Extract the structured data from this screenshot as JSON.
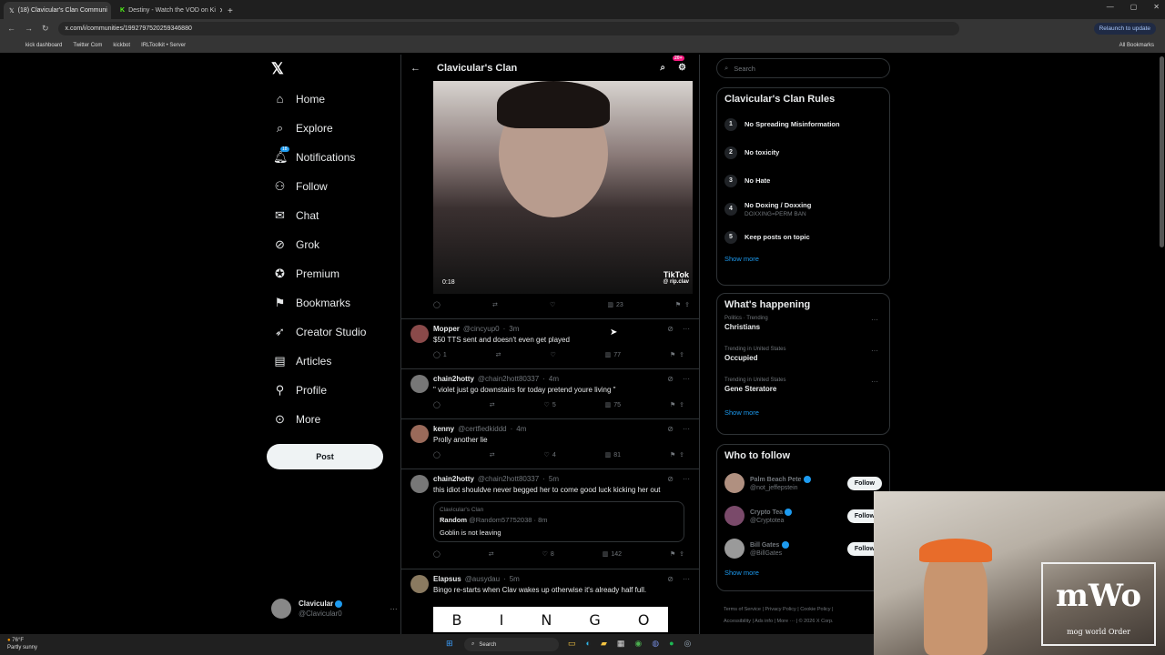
{
  "browser": {
    "tabs": [
      {
        "label": "(18) Clavicular's Clan Communi",
        "icon": "x-icon",
        "active": true
      },
      {
        "label": "Destiny - Watch the VOD on Ki",
        "icon": "kick-icon",
        "active": false
      }
    ],
    "url": "x.com/i/communities/1992797520259346880",
    "relaunch": "Relaunch to update",
    "bookmarks": [
      "kick dashboard",
      "Twitter Com",
      "kickbot",
      "IRLToolkit • Server"
    ],
    "all_bookmarks": "All Bookmarks"
  },
  "nav": {
    "items": [
      {
        "label": "Home",
        "icon": "home-icon"
      },
      {
        "label": "Explore",
        "icon": "search-icon"
      },
      {
        "label": "Notifications",
        "icon": "bell-icon",
        "badge": "18"
      },
      {
        "label": "Follow",
        "icon": "add-person-icon"
      },
      {
        "label": "Chat",
        "icon": "mail-icon"
      },
      {
        "label": "Grok",
        "icon": "grok-icon"
      },
      {
        "label": "Premium",
        "icon": "verified-icon"
      },
      {
        "label": "Bookmarks",
        "icon": "bookmark-icon"
      },
      {
        "label": "Creator Studio",
        "icon": "rocket-icon"
      },
      {
        "label": "Articles",
        "icon": "article-icon"
      },
      {
        "label": "Profile",
        "icon": "person-icon"
      },
      {
        "label": "More",
        "icon": "more-circle-icon"
      }
    ],
    "post": "Post",
    "account": {
      "name": "Clavicular",
      "handle": "@Clavicular0"
    }
  },
  "community": {
    "title": "Clavicular's Clan",
    "badge": "20+",
    "video": {
      "time": "0:18",
      "brand": "TikTok",
      "user": "@ rip.clav"
    },
    "video_views": "23"
  },
  "tweets": [
    {
      "name": "Mopper",
      "handle": "@cincyup0",
      "time": "3m",
      "text": "$50 TTS sent and doesn't even get played",
      "replies": "1",
      "likes": "",
      "views": "77"
    },
    {
      "name": "chain2hotty",
      "handle": "@chain2hott80337",
      "time": "4m",
      "text": "\" violet just go downstairs for today pretend youre living \"",
      "replies": "",
      "likes": "5",
      "views": "75"
    },
    {
      "name": "kenny",
      "handle": "@certfiedkiddd",
      "time": "4m",
      "text": "Prolly another lie",
      "replies": "",
      "likes": "4",
      "views": "81"
    },
    {
      "name": "chain2hotty",
      "handle": "@chain2hott80337",
      "time": "5m",
      "text": "this idiot shouldve never begged her to come good luck kicking her out",
      "replies": "",
      "likes": "8",
      "views": "142",
      "quote": {
        "community": "Clavicular's Clan",
        "name": "Random",
        "handle": "@Random57752038",
        "time": "8m",
        "text": "Goblin is not leaving"
      }
    },
    {
      "name": "Elapsus",
      "handle": "@ausydau",
      "time": "5m",
      "text": "Bingo re-starts when Clav wakes up otherwise it's already half full.",
      "bingo": [
        "B",
        "I",
        "N",
        "G",
        "O"
      ]
    }
  ],
  "sidebar": {
    "search_placeholder": "Search",
    "rules_title": "Clavicular's Clan Rules",
    "rules": [
      {
        "n": "1",
        "text": "No Spreading Misinformation",
        "sub": ""
      },
      {
        "n": "2",
        "text": "No toxicity",
        "sub": ""
      },
      {
        "n": "3",
        "text": "No Hate",
        "sub": ""
      },
      {
        "n": "4",
        "text": "No Doxing / Doxxing",
        "sub": "DOXXING=PERM BAN"
      },
      {
        "n": "5",
        "text": "Keep posts on topic",
        "sub": ""
      }
    ],
    "show_more": "Show more",
    "happening_title": "What's happening",
    "trends": [
      {
        "context": "Politics · Trending",
        "topic": "Christians"
      },
      {
        "context": "Trending in United States",
        "topic": "Occupied"
      },
      {
        "context": "Trending in United States",
        "topic": "Gene Steratore"
      }
    ],
    "follow_title": "Who to follow",
    "follow": [
      {
        "name": "Palm Beach Pete",
        "handle": "@not_jeffepstein"
      },
      {
        "name": "Crypto Tea",
        "handle": "@Cryptotea"
      },
      {
        "name": "Bill Gates",
        "handle": "@BillGates"
      }
    ],
    "follow_btn": "Follow",
    "footer": [
      "Terms of Service",
      "Privacy Policy",
      "Cookie Policy",
      "Accessibility",
      "Ads info",
      "More ···",
      "© 2026 X Corp."
    ]
  },
  "overlay": {
    "logo_big": "mWo",
    "logo_small": "mog world Order"
  },
  "taskbar": {
    "temp": "76°F",
    "weather": "Partly sunny",
    "search": "Search"
  }
}
